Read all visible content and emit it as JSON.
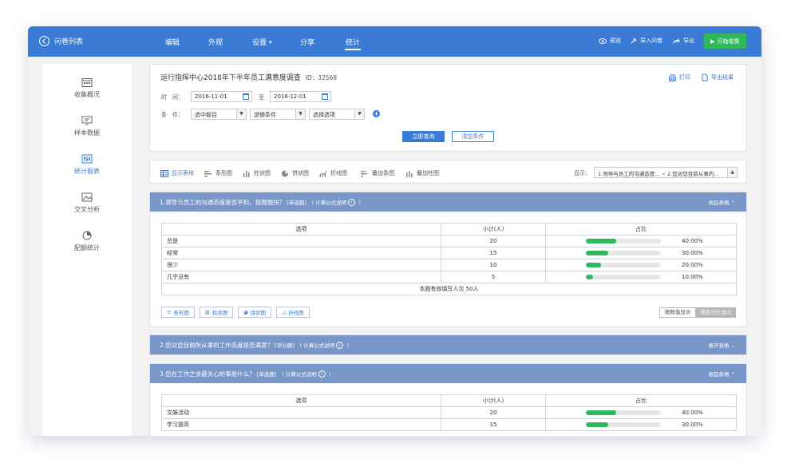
{
  "topbar": {
    "back_label": "问卷列表",
    "tabs": [
      {
        "label": "编辑",
        "active": false
      },
      {
        "label": "外观",
        "active": false
      },
      {
        "label": "设置",
        "active": false,
        "dropdown": true
      },
      {
        "label": "分享",
        "active": false
      },
      {
        "label": "统计",
        "active": true
      }
    ],
    "preview": "预览",
    "import": "导入问卷",
    "export": "导出",
    "start": "开始收集"
  },
  "sidebar": {
    "items": [
      {
        "label": "收集概况",
        "icon": "calendar-grid-icon",
        "active": false
      },
      {
        "label": "样本数据",
        "icon": "monitor-icon",
        "active": false
      },
      {
        "label": "统计报表",
        "icon": "sliders-icon",
        "active": true
      },
      {
        "label": "交叉分析",
        "icon": "image-icon",
        "active": false
      },
      {
        "label": "配额统计",
        "icon": "pie-icon",
        "active": false
      }
    ]
  },
  "filter": {
    "title": "运行指挥中心2018年下半年员工满意度调查",
    "id_text": "ID：32568",
    "print": "打印",
    "export_result": "导出结果",
    "time_label": "时　间：",
    "date_from": "2016-11-01",
    "to_label": "至",
    "date_to": "2016-12-01",
    "cond_label": "条　件：",
    "select1": "选中题目",
    "select2": "逻辑条件",
    "select3": "选择选项",
    "query_btn": "立即查询",
    "clear_btn": "清空条件"
  },
  "viewbar": {
    "tabs": [
      {
        "label": "显示表格",
        "active": true
      },
      {
        "label": "条形图",
        "active": false
      },
      {
        "label": "柱状图",
        "active": false
      },
      {
        "label": "饼状图",
        "active": false
      },
      {
        "label": "折线图",
        "active": false
      },
      {
        "label": "叠加条图",
        "active": false
      },
      {
        "label": "叠加柱图",
        "active": false
      }
    ],
    "display_label": "显示：",
    "display_value1": "1.领导与员工的沟通态度...",
    "display_value2": "2.您对您目前从事的..."
  },
  "q1": {
    "title": "1.领导与员工的沟通态度是否平和，氛围愉快？",
    "type": "[单选题]",
    "formula": "（ 计算公式说明",
    "formula_end": "）",
    "toggle": "收起表格 ⌃",
    "headers": [
      "选项",
      "小计(人)",
      "占比"
    ],
    "rows": [
      {
        "option": "总是",
        "count": "20",
        "pct": "40.00%",
        "ratio": 0.4
      },
      {
        "option": "经常",
        "count": "15",
        "pct": "30.00%",
        "ratio": 0.3
      },
      {
        "option": "很少",
        "count": "10",
        "pct": "20.00%",
        "ratio": 0.2
      },
      {
        "option": "几乎没有",
        "count": "5",
        "pct": "10.00%",
        "ratio": 0.1
      }
    ],
    "summary": "本题有效填写人次   50人",
    "chart_buttons": [
      "条形图",
      "柱状图",
      "饼状图",
      "折线图"
    ],
    "by_value": "按数值显示",
    "by_percent": "按百分比显示"
  },
  "q2": {
    "title": "2.您对您目前所从事的工作态度是否满意？",
    "type": "[评分题]",
    "formula": "（ 计算公式说明",
    "formula_end": "）",
    "toggle": "展开表格 ⌄"
  },
  "q3": {
    "title": "3.您在工作之余最关心的事是什么？",
    "type": "[单选题]",
    "formula": "（ 计算公式说明",
    "formula_end": "）",
    "toggle": "收起表格 ⌃",
    "headers": [
      "选项",
      "小计(人)",
      "占比"
    ],
    "rows": [
      {
        "option": "文娱活动",
        "count": "20",
        "pct": "40.00%",
        "ratio": 0.4
      },
      {
        "option": "学习提高",
        "count": "15",
        "pct": "30.00%",
        "ratio": 0.3
      }
    ]
  }
}
